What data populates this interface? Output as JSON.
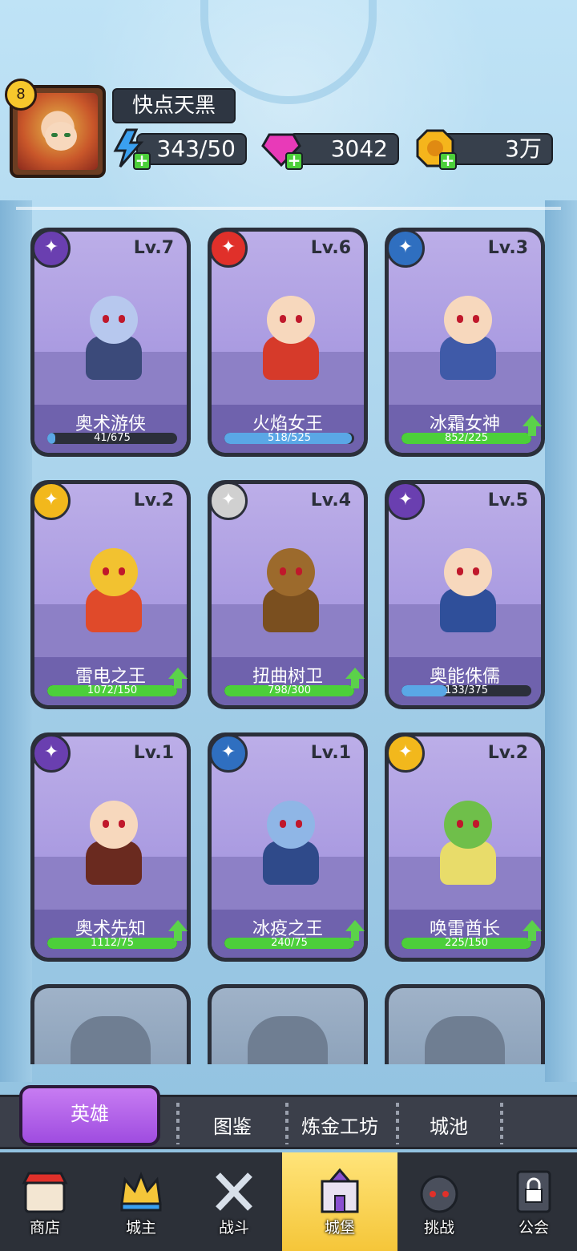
{
  "player": {
    "level": "8",
    "name": "快点天黑",
    "energy": "343/50",
    "gems": "3042",
    "gold": "3万"
  },
  "heroes": [
    {
      "name": "奥术游侠",
      "level": "Lv.7",
      "progress": "41/675",
      "fill": 0.06,
      "color": "#5aa7e6",
      "upgrade": false,
      "class_icon": "arrows-icon",
      "icon_bg": "#6a3fb0",
      "skin": "#b7c8ee",
      "outfit": "#3b4a7a"
    },
    {
      "name": "火焰女王",
      "level": "Lv.6",
      "progress": "518/525",
      "fill": 0.98,
      "color": "#5aa7e6",
      "upgrade": false,
      "class_icon": "fire-ring-icon",
      "icon_bg": "#e0302a",
      "skin": "#f7d8bd",
      "outfit": "#d63a2a"
    },
    {
      "name": "冰霜女神",
      "level": "Lv.3",
      "progress": "852/225",
      "fill": 1.0,
      "color": "#4ccf3a",
      "upgrade": true,
      "class_icon": "crystal-icon",
      "icon_bg": "#2f6fc0",
      "skin": "#f7d8bd",
      "outfit": "#3f5aa8"
    },
    {
      "name": "雷电之王",
      "level": "Lv.2",
      "progress": "1072/150",
      "fill": 1.0,
      "color": "#4ccf3a",
      "upgrade": true,
      "class_icon": "lightning-icon",
      "icon_bg": "#f2b81c",
      "skin": "#f2c230",
      "outfit": "#e04a2a"
    },
    {
      "name": "扭曲树卫",
      "level": "Lv.4",
      "progress": "798/300",
      "fill": 1.0,
      "color": "#4ccf3a",
      "upgrade": true,
      "class_icon": "helmet-icon",
      "icon_bg": "#d0d0d0",
      "skin": "#9c6a2c",
      "outfit": "#7a4f1f"
    },
    {
      "name": "奥能侏儒",
      "level": "Lv.5",
      "progress": "133/375",
      "fill": 0.35,
      "color": "#5aa7e6",
      "upgrade": false,
      "class_icon": "arcane-icon",
      "icon_bg": "#6a3fb0",
      "skin": "#f7d8bd",
      "outfit": "#2f4f9a"
    },
    {
      "name": "奥术先知",
      "level": "Lv.1",
      "progress": "1112/75",
      "fill": 1.0,
      "color": "#4ccf3a",
      "upgrade": true,
      "class_icon": "arrows-icon",
      "icon_bg": "#6a3fb0",
      "skin": "#f7d8bd",
      "outfit": "#6a2a1f"
    },
    {
      "name": "冰疫之王",
      "level": "Lv.1",
      "progress": "240/75",
      "fill": 1.0,
      "color": "#4ccf3a",
      "upgrade": true,
      "class_icon": "crystal-icon",
      "icon_bg": "#2f6fc0",
      "skin": "#8fb6e6",
      "outfit": "#2f4a8a"
    },
    {
      "name": "唤雷酋长",
      "level": "Lv.2",
      "progress": "225/150",
      "fill": 1.0,
      "color": "#4ccf3a",
      "upgrade": true,
      "class_icon": "lightning-icon",
      "icon_bg": "#f2b81c",
      "skin": "#6fbf4a",
      "outfit": "#e8dc6a"
    }
  ],
  "subtabs": {
    "heroes": "英雄",
    "codex": "图鉴",
    "alchemy": "炼金工坊",
    "city": "城池"
  },
  "nav": {
    "shop": "商店",
    "lord": "城主",
    "battle": "战斗",
    "castle": "城堡",
    "challenge": "挑战",
    "guild": "公会"
  }
}
